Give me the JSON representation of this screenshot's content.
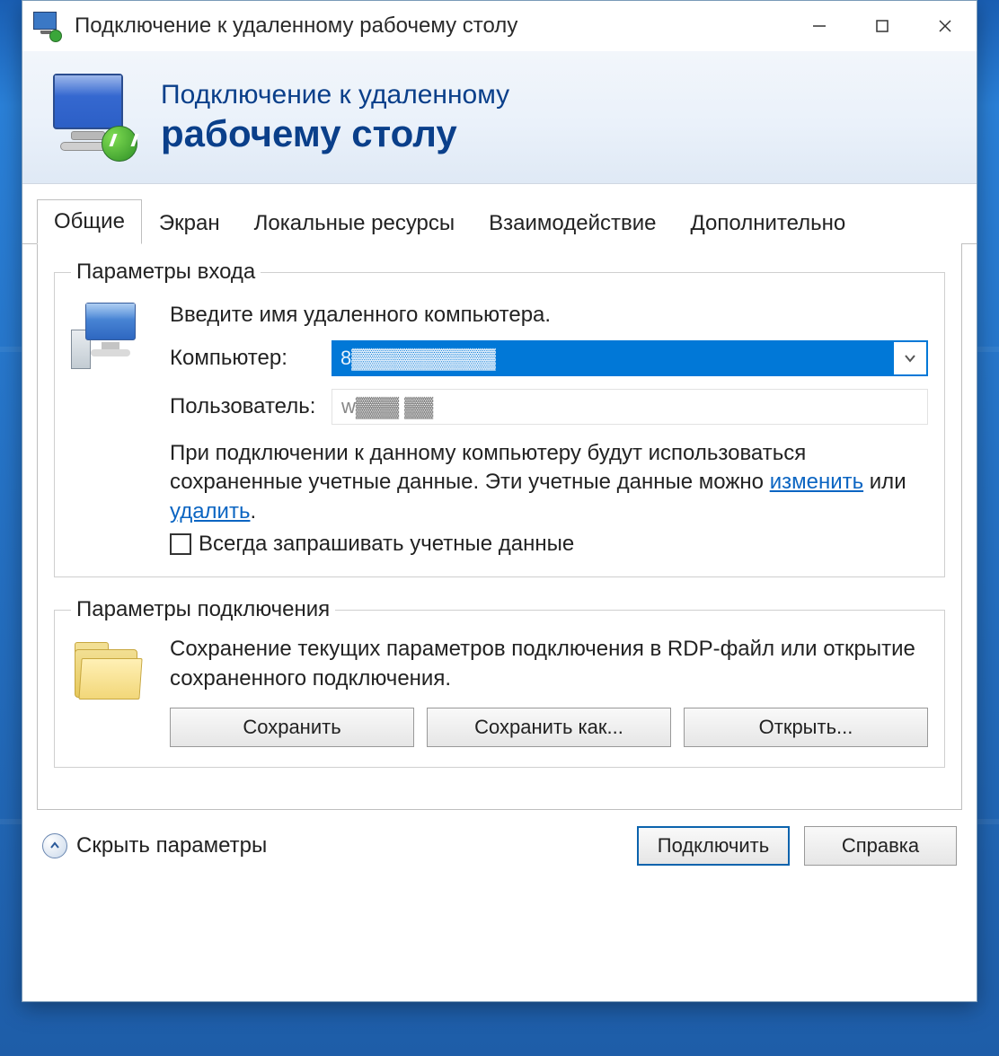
{
  "window": {
    "title": "Подключение к удаленному рабочему столу"
  },
  "header": {
    "line1": "Подключение к удаленному",
    "line2": "рабочему столу"
  },
  "tabs": [
    {
      "label": "Общие",
      "active": true
    },
    {
      "label": "Экран"
    },
    {
      "label": "Локальные ресурсы"
    },
    {
      "label": "Взаимодействие"
    },
    {
      "label": "Дополнительно"
    }
  ],
  "login_group": {
    "legend": "Параметры входа",
    "intro": "Введите имя удаленного компьютера.",
    "computer_label": "Компьютер:",
    "computer_value": "8▓▓▓▓▓▓▓▓▓▓",
    "user_label": "Пользователь:",
    "user_value": "w▓▓▓  ▓▓",
    "note_pre": "При подключении к данному компьютеру будут использоваться сохраненные учетные данные.  Эти учетные данные можно ",
    "link_change": "изменить",
    "note_or": " или ",
    "link_delete": "удалить",
    "note_end": ".",
    "checkbox_label": "Всегда запрашивать учетные данные"
  },
  "conn_group": {
    "legend": "Параметры подключения",
    "text": "Сохранение текущих параметров подключения в RDP-файл или открытие сохраненного подключения.",
    "save": "Сохранить",
    "save_as": "Сохранить как...",
    "open": "Открыть..."
  },
  "footer": {
    "toggle": "Скрыть параметры",
    "connect": "Подключить",
    "help": "Справка"
  }
}
